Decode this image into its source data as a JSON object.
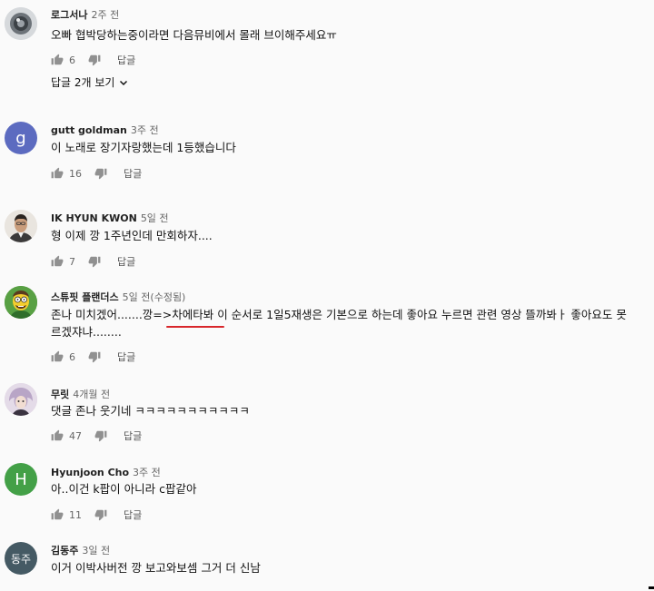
{
  "comments": [
    {
      "author": "로그서나",
      "time": "2주 전",
      "text": "오빠 협박당하는중이라면 다음뮤비에서 몰래 브이해주세요ㅠ",
      "likes": "6",
      "reply": "답글",
      "view_replies": "답글 2개 보기",
      "avatar_icon": "camera-lens-icon",
      "avatar_color": "#6d7379"
    },
    {
      "author": "gutt goldman",
      "time": "3주 전",
      "text": "이 노래로 장기자랑했는데 1등했습니다",
      "likes": "16",
      "reply": "답글",
      "avatar_letter": "g",
      "avatar_color": "#5c6bc0"
    },
    {
      "author": "IK HYUN KWON",
      "time": "5일 전",
      "text": "형 이제 깡 1주년인데 만회하자....",
      "likes": "7",
      "reply": "답글",
      "avatar_icon": "man-portrait-icon",
      "avatar_color": "#8a7a6a"
    },
    {
      "author": "스튜핏 플랜더스",
      "time": "5일 전(수정됨)",
      "text_line1": "존나 미치겠어.......깡=>차에타봐 이 순서로 1일5재생은 기본으로 하는데 좋아요 누르면 관련 영상 뜰까봐ㅏ 좋아요도 못",
      "text_line2": "르겠쟈냐........",
      "likes": "6",
      "reply": "답글",
      "avatar_icon": "cartoon-flanders-icon",
      "avatar_color": "#4f8a3a",
      "underline_color": "#d8262b"
    },
    {
      "author": "무릿",
      "time": "4개월 전",
      "text": "댓글 존나 웃기네 ㅋㅋㅋㅋㅋㅋㅋㅋㅋㅋㅋ",
      "likes": "47",
      "reply": "답글",
      "avatar_icon": "anime-character-icon",
      "avatar_color": "#b9a6c4"
    },
    {
      "author": "Hyunjoon Cho",
      "time": "3주 전",
      "text": "아..이건 k팝이 아니라 c팝같아",
      "likes": "11",
      "reply": "답글",
      "avatar_letter": "H",
      "avatar_color": "#43a047"
    },
    {
      "author": "김동주",
      "time": "3일 전",
      "text": "이거 이박사버전 깡 보고와보셈 그거 더 신남",
      "avatar_letter": "동주",
      "avatar_color": "#455a64"
    }
  ],
  "icons": {
    "like": "thumb-up-icon",
    "dislike": "thumb-down-icon",
    "expand": "chevron-down-icon"
  }
}
